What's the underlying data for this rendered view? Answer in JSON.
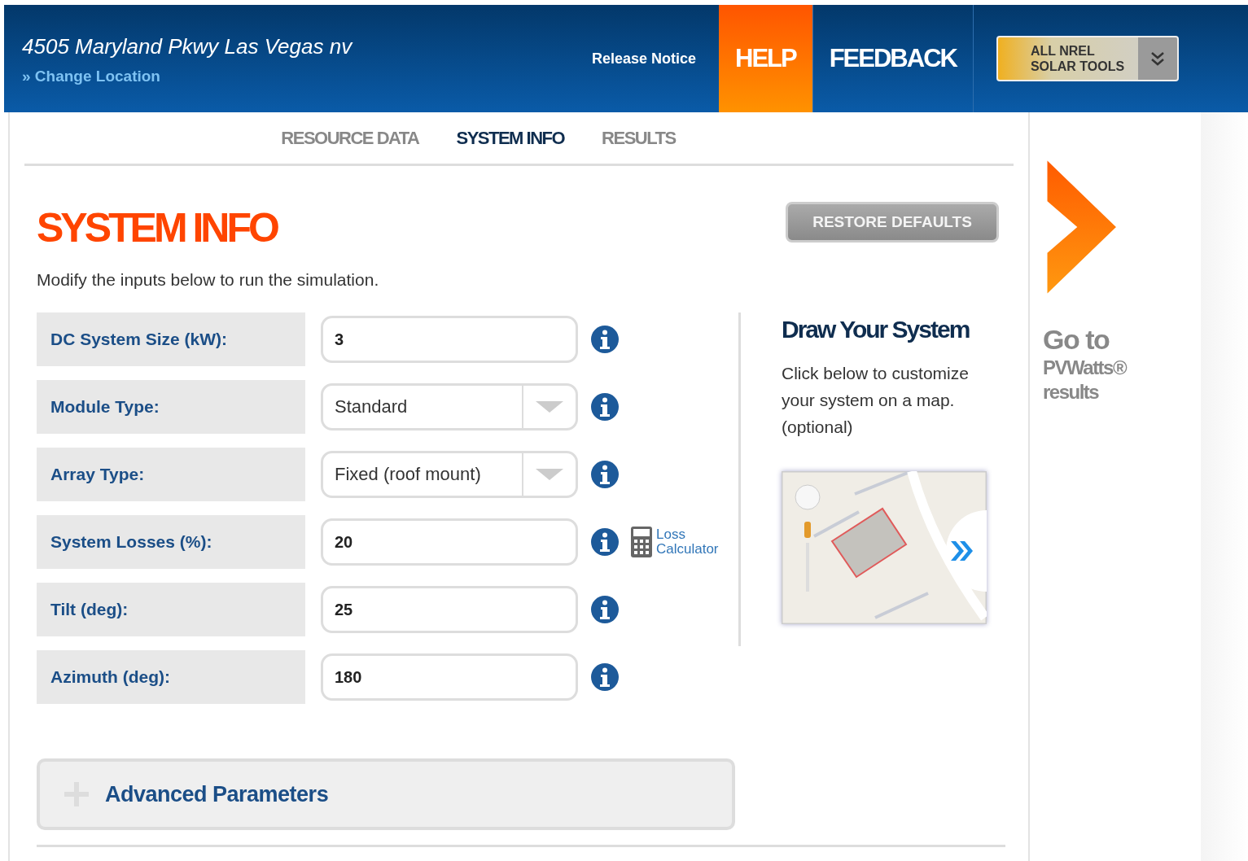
{
  "header": {
    "location": "4505 Maryland Pkwy Las Vegas nv",
    "change_location": "» Change Location",
    "release_notice": "Release Notice",
    "nav": [
      {
        "label": "HELP",
        "selected": true
      },
      {
        "label": "FEEDBACK",
        "selected": false
      }
    ],
    "tools": {
      "line1": "ALL NREL",
      "line2": "SOLAR TOOLS"
    }
  },
  "tabs": [
    {
      "label": "RESOURCE DATA",
      "selected": false
    },
    {
      "label": "SYSTEM INFO",
      "selected": true
    },
    {
      "label": "RESULTS",
      "selected": false
    }
  ],
  "title": "SYSTEM INFO",
  "restore_button": "RESTORE DEFAULTS",
  "intro": "Modify the inputs below to run the simulation.",
  "fields": [
    {
      "label": "DC System Size (kW):",
      "kind": "text",
      "value": "3"
    },
    {
      "label": "Module Type:",
      "kind": "select",
      "value": "Standard"
    },
    {
      "label": "Array Type:",
      "kind": "select",
      "value": "Fixed (roof mount)"
    },
    {
      "label": "System Losses (%):",
      "kind": "text",
      "value": "20",
      "link": "Loss Calculator"
    },
    {
      "label": "Tilt (deg):",
      "kind": "text",
      "value": "25"
    },
    {
      "label": "Azimuth (deg):",
      "kind": "text",
      "value": "180"
    }
  ],
  "advanced": {
    "label": "Advanced Parameters",
    "expanded": false
  },
  "draw_system": {
    "title": "Draw Your System",
    "text": "Click below to customize your system on a map. (optional)"
  },
  "next": {
    "line1": "Go to",
    "line2": "PVWatts®",
    "line3": "results"
  }
}
